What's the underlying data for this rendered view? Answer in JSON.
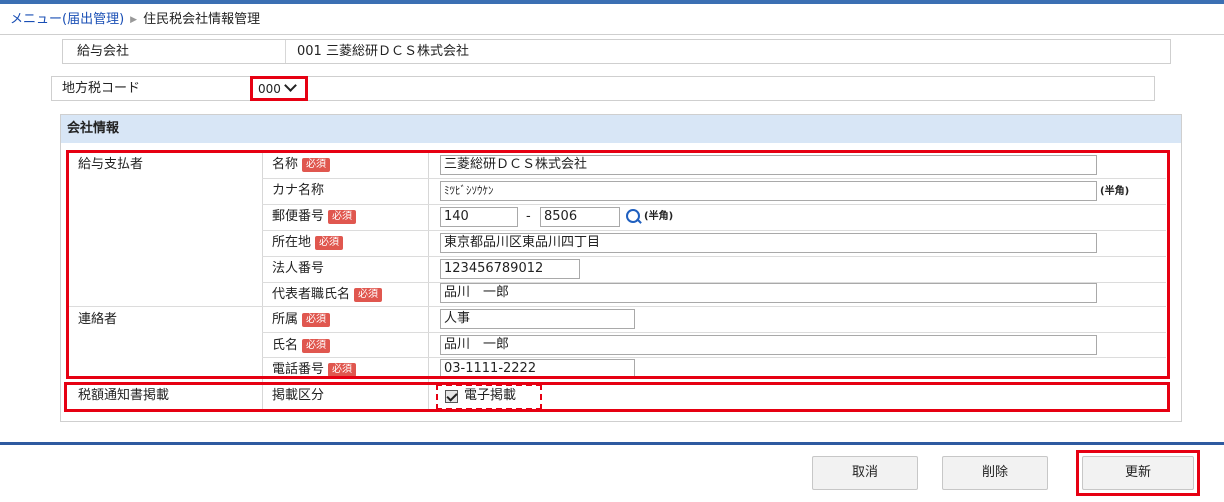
{
  "breadcrumb": {
    "menu": "メニュー(届出管理)",
    "current": "住民税会社情報管理"
  },
  "payroll_company": {
    "label": "給与会社",
    "value": "001 三菱総研ＤＣＳ株式会社"
  },
  "local_tax_code": {
    "label": "地方税コード",
    "value": "000"
  },
  "section": {
    "title": "会社情報"
  },
  "required_badge": "必須",
  "groups": {
    "payer": "給与支払者",
    "contact": "連絡者",
    "notice": "税額通知書掲載"
  },
  "fields": {
    "name": {
      "label": "名称",
      "value": "三菱総研ＤＣＳ株式会社"
    },
    "kana": {
      "label": "カナ名称",
      "value": "ﾐﾂﾋﾞｼｿｳｹﾝ",
      "note": "(半角)"
    },
    "postal": {
      "label": "郵便番号",
      "value1": "140",
      "dash": "-",
      "value2": "8506",
      "note": "(半角)"
    },
    "address": {
      "label": "所在地",
      "value": "東京都品川区東品川四丁目"
    },
    "corp_number": {
      "label": "法人番号",
      "value": "123456789012"
    },
    "rep_name": {
      "label": "代表者職氏名",
      "value": "品川　一郎"
    },
    "department": {
      "label": "所属",
      "value": "人事"
    },
    "contact_name": {
      "label": "氏名",
      "value": "品川　一郎"
    },
    "phone": {
      "label": "電話番号",
      "value": "03-1111-2222"
    },
    "publication": {
      "label": "掲載区分",
      "checkbox_label": "電子掲載",
      "checked": true
    }
  },
  "buttons": {
    "cancel": "取消",
    "delete": "削除",
    "update": "更新"
  },
  "colors": {
    "accent": "#3b6fb3",
    "highlight": "#e60012",
    "section_bg": "#d8e6f6",
    "required": "#e0574f"
  },
  "icons": {
    "search": "search-icon",
    "select": "chevron-down-icon"
  }
}
